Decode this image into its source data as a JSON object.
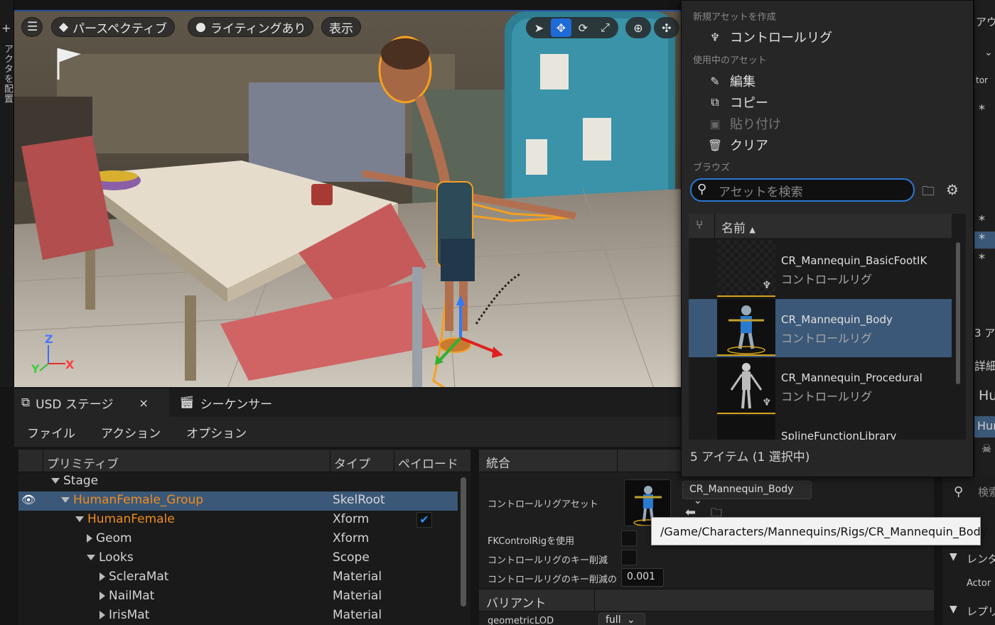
{
  "left_strip": {
    "plus": "+",
    "vertical_label": "アクタを配置"
  },
  "viewport": {
    "menu_icon": "hamburger-icon",
    "perspective_label": "パースペクティブ",
    "lighting_label": "ライティングあり",
    "show_label": "表示",
    "axes": {
      "z": "Z",
      "y": "Y",
      "x": "X"
    }
  },
  "tabs": [
    {
      "label": "USD ステージ",
      "close": "×"
    },
    {
      "label": "シーケンサー"
    }
  ],
  "menubar": [
    "ファイル",
    "アクション",
    "オプション"
  ],
  "tree": {
    "columns": [
      "プリミティブ",
      "タイプ",
      "ペイロード"
    ],
    "rows": [
      {
        "name": "Stage",
        "type": ""
      },
      {
        "name": "HumanFemale_Group",
        "type": "SkelRoot"
      },
      {
        "name": "HumanFemale",
        "type": "Xform"
      },
      {
        "name": "Geom",
        "type": "Xform"
      },
      {
        "name": "Looks",
        "type": "Scope"
      },
      {
        "name": "ScleraMat",
        "type": "Material"
      },
      {
        "name": "NailMat",
        "type": "Material"
      },
      {
        "name": "IrisMat",
        "type": "Material"
      }
    ]
  },
  "details": {
    "section_integration": "統合",
    "control_rig_asset_label": "コントロールリグアセット",
    "control_rig_asset_value": "CR_Mannequin_Body",
    "use_fk_label": "FKControlRigを使用",
    "reduce_keys_label": "コントロールリグのキー削減",
    "reduce_tolerance_label": "コントロールリグのキー削減の",
    "reduce_tolerance_value": "0.001",
    "section_variant": "バリアント",
    "geometric_lod_label": "geometricLOD",
    "geometric_lod_value": "full"
  },
  "tooltip": "/Game/Characters/Mannequins/Rigs/CR_Mannequin_Body",
  "menu": {
    "section_create": "新規アセットを作成",
    "create_control_rig": "コントロールリグ",
    "section_current": "使用中のアセット",
    "edit": "編集",
    "copy": "コピー",
    "paste": "貼り付け",
    "clear": "クリア",
    "section_browse": "ブラウズ",
    "search_placeholder": "アセットを検索",
    "column_name": "名前",
    "assets": [
      {
        "name": "CR_Mannequin_BasicFootIK",
        "type": "コントロールリグ"
      },
      {
        "name": "CR_Mannequin_Body",
        "type": "コントロールリグ"
      },
      {
        "name": "CR_Mannequin_Procedural",
        "type": "コントロールリグ"
      },
      {
        "name": "SplineFunctionLibrary",
        "type": ""
      }
    ],
    "status": "5 アイテム (1 選択中)"
  },
  "right_strip": {
    "top": "アウ",
    "tor": "tor",
    "a3": "3 ア",
    "details": "詳細",
    "hu1": "Hu",
    "hu2": "Hur",
    "search": "検索",
    "render": "レンダ",
    "actor": "Actor",
    "replicate": "レプリ"
  }
}
